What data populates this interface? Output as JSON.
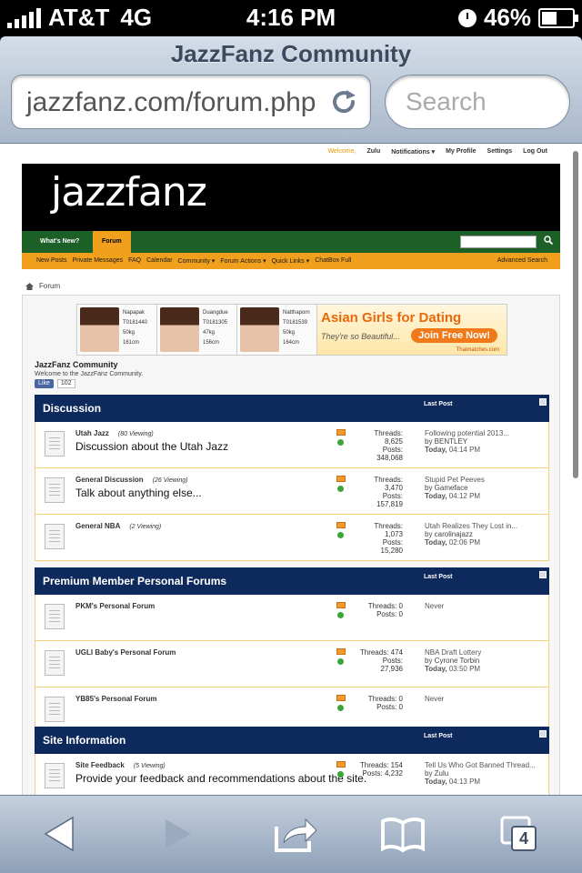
{
  "status_bar": {
    "carrier": "AT&T",
    "network": "4G",
    "time": "4:16 PM",
    "battery": "46%"
  },
  "safari": {
    "page_title": "JazzFanz Community",
    "url": "jazzfanz.com/forum.php",
    "search_placeholder": "Search",
    "tab_count": "4"
  },
  "toplinks": {
    "welcome": "Welcome,",
    "user": "Zulu",
    "notifications": "Notifications ▾",
    "profile": "My Profile",
    "settings": "Settings",
    "logout": "Log Out"
  },
  "site": {
    "logo": "jazzfanz"
  },
  "nav": {
    "whats_new": "What's New?",
    "forum": "Forum"
  },
  "subnav": {
    "items": [
      "New Posts",
      "Private Messages",
      "FAQ",
      "Calendar",
      "Community ▾",
      "Forum Actions ▾",
      "Quick Links ▾",
      "ChatBox Full"
    ],
    "advanced_search": "Advanced Search"
  },
  "breadcrumb": "Forum",
  "ad": {
    "profiles": [
      {
        "name": "Napapak",
        "id": "T0181440",
        "weight": "50kg",
        "height": "161cm"
      },
      {
        "name": "Duangdue",
        "id": "T0181305",
        "weight": "47kg",
        "height": "156cm"
      },
      {
        "name": "Natthaporn",
        "id": "T0181539",
        "weight": "50kg",
        "height": "164cm"
      }
    ],
    "headline": "Asian Girls for Dating",
    "sub": "They're so Beautiful...",
    "cta": "Join Free Now!",
    "domain": "Thaimatches.com"
  },
  "community": {
    "title": "JazzFanz Community",
    "subtitle": "Welcome to the JazzFanz Community.",
    "like": "Like",
    "like_count": "102"
  },
  "sections": [
    {
      "title": "Discussion",
      "last_post_header": "Last Post",
      "forums": [
        {
          "name": "Utah Jazz",
          "viewing": "(80 Viewing)",
          "desc": "Discussion about the Utah Jazz",
          "threads_label": "Threads:",
          "threads": "8,625",
          "posts_label": "Posts:",
          "posts": "348,068",
          "lp_title": "Following potential 2013...",
          "lp_by": "by BENTLEY",
          "lp_day": "Today,",
          "lp_time": "04:14 PM"
        },
        {
          "name": "General Discussion",
          "viewing": "(26 Viewing)",
          "desc": "Talk about anything else...",
          "threads_label": "Threads:",
          "threads": "3,470",
          "posts_label": "Posts:",
          "posts": "157,819",
          "lp_title": "Stupid Pet Peeves",
          "lp_by": "by Gameface",
          "lp_day": "Today,",
          "lp_time": "04:12 PM"
        },
        {
          "name": "General NBA",
          "viewing": "(2 Viewing)",
          "desc": "",
          "threads_label": "Threads:",
          "threads": "1,073",
          "posts_label": "Posts:",
          "posts": "15,280",
          "lp_title": "Utah Realizes They Lost in...",
          "lp_by": "by carolinajazz",
          "lp_day": "Today,",
          "lp_time": "02:06 PM"
        }
      ]
    },
    {
      "title": "Premium Member Personal Forums",
      "last_post_header": "Last Post",
      "forums": [
        {
          "name": "PKM's Personal Forum",
          "viewing": "",
          "desc": "",
          "threads_label": "Threads: 0",
          "threads": "",
          "posts_label": "Posts: 0",
          "posts": "",
          "lp_title": "Never",
          "lp_by": "",
          "lp_day": "",
          "lp_time": ""
        },
        {
          "name": "UGLI Baby's Personal Forum",
          "viewing": "",
          "desc": "",
          "threads_label": "Threads: 474",
          "threads": "",
          "posts_label": "Posts:",
          "posts": "27,936",
          "lp_title": "NBA Draft Lottery",
          "lp_by": "by Cyrone Torbin",
          "lp_day": "Today,",
          "lp_time": "03:50 PM"
        },
        {
          "name": "YB85's Personal Forum",
          "viewing": "",
          "desc": "",
          "threads_label": "Threads: 0",
          "threads": "",
          "posts_label": "Posts: 0",
          "posts": "",
          "lp_title": "Never",
          "lp_by": "",
          "lp_day": "",
          "lp_time": ""
        }
      ]
    },
    {
      "title": "Site Information",
      "last_post_header": "Last Post",
      "forums": [
        {
          "name": "Site Feedback",
          "viewing": "(5 Viewing)",
          "desc": "Provide your feedback and recommendations about the site.",
          "threads_label": "Threads: 154",
          "threads": "",
          "posts_label": "Posts: 4,232",
          "posts": "",
          "lp_title": "Tell Us Who Got Banned Thread...",
          "lp_by": "by Zulu",
          "lp_day": "Today,",
          "lp_time": "04:13 PM"
        }
      ]
    }
  ],
  "colors": {
    "brand_green": "#1c5f27",
    "brand_orange": "#f0a01c",
    "section_navy": "#0e2a5c"
  }
}
